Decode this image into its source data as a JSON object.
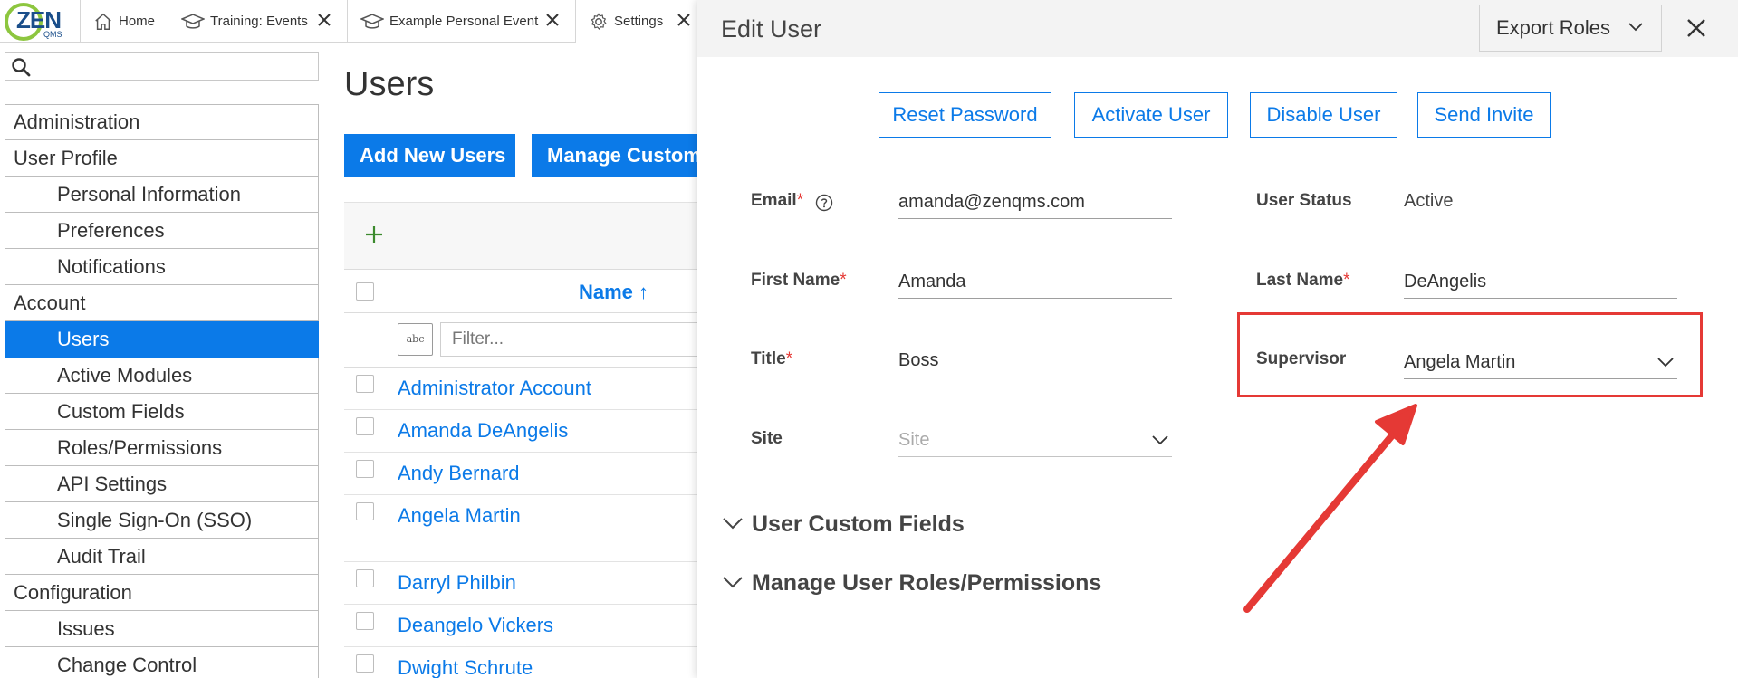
{
  "logo": {
    "text": "ZEN",
    "sub": "QMS"
  },
  "tabs": [
    {
      "label": "Home",
      "icon": "home-icon",
      "closable": false
    },
    {
      "label": "Training: Events",
      "icon": "mortarboard-icon",
      "closable": true
    },
    {
      "label": "Example Personal Event",
      "icon": "mortarboard-icon",
      "closable": true
    },
    {
      "label": "Settings",
      "icon": "gear-icon",
      "closable": true
    }
  ],
  "sidebar": {
    "search_placeholder": "",
    "items": [
      {
        "label": "Administration",
        "level": "section"
      },
      {
        "label": "User Profile",
        "level": "section"
      },
      {
        "label": "Personal Information",
        "level": "child"
      },
      {
        "label": "Preferences",
        "level": "child"
      },
      {
        "label": "Notifications",
        "level": "child"
      },
      {
        "label": "Account",
        "level": "section"
      },
      {
        "label": "Users",
        "level": "child",
        "selected": true
      },
      {
        "label": "Active Modules",
        "level": "child"
      },
      {
        "label": "Custom Fields",
        "level": "child"
      },
      {
        "label": "Roles/Permissions",
        "level": "child"
      },
      {
        "label": "API Settings",
        "level": "child"
      },
      {
        "label": "Single Sign-On (SSO)",
        "level": "child"
      },
      {
        "label": "Audit Trail",
        "level": "child"
      },
      {
        "label": "Configuration",
        "level": "section"
      },
      {
        "label": "Issues",
        "level": "child"
      },
      {
        "label": "Change Control",
        "level": "child"
      }
    ]
  },
  "users_page": {
    "title": "Users",
    "add_button": "Add New Users",
    "manage_button": "Manage Custom",
    "grid": {
      "name_header": "Name",
      "sort_indicator": "↑",
      "filter_type_label": "abc",
      "filter_placeholder": "Filter...",
      "rows": [
        "Administrator Account",
        "Amanda DeAngelis",
        "Andy Bernard",
        "Angela Martin",
        "Darryl Philbin",
        "Deangelo Vickers",
        "Dwight Schrute"
      ]
    }
  },
  "edit_user": {
    "title": "Edit User",
    "export_roles": "Export Roles",
    "actions": {
      "reset_password": "Reset Password",
      "activate_user": "Activate User",
      "disable_user": "Disable User",
      "send_invite": "Send Invite"
    },
    "fields": {
      "email": {
        "label": "Email",
        "required": "*",
        "value": "amanda@zenqms.com"
      },
      "user_status": {
        "label": "User Status",
        "value": "Active"
      },
      "first_name": {
        "label": "First Name",
        "required": "*",
        "value": "Amanda"
      },
      "last_name": {
        "label": "Last Name",
        "required": "*",
        "value": "DeAngelis"
      },
      "title": {
        "label": "Title",
        "required": "*",
        "value": "Boss"
      },
      "supervisor": {
        "label": "Supervisor",
        "value": "Angela Martin"
      },
      "site": {
        "label": "Site",
        "placeholder": "Site"
      }
    },
    "sections": {
      "custom_fields": "User Custom Fields",
      "roles": "Manage User Roles/Permissions"
    }
  },
  "colors": {
    "accent": "#0b7ae8",
    "highlight": "#e53935",
    "brand_green": "#8dc63f"
  }
}
